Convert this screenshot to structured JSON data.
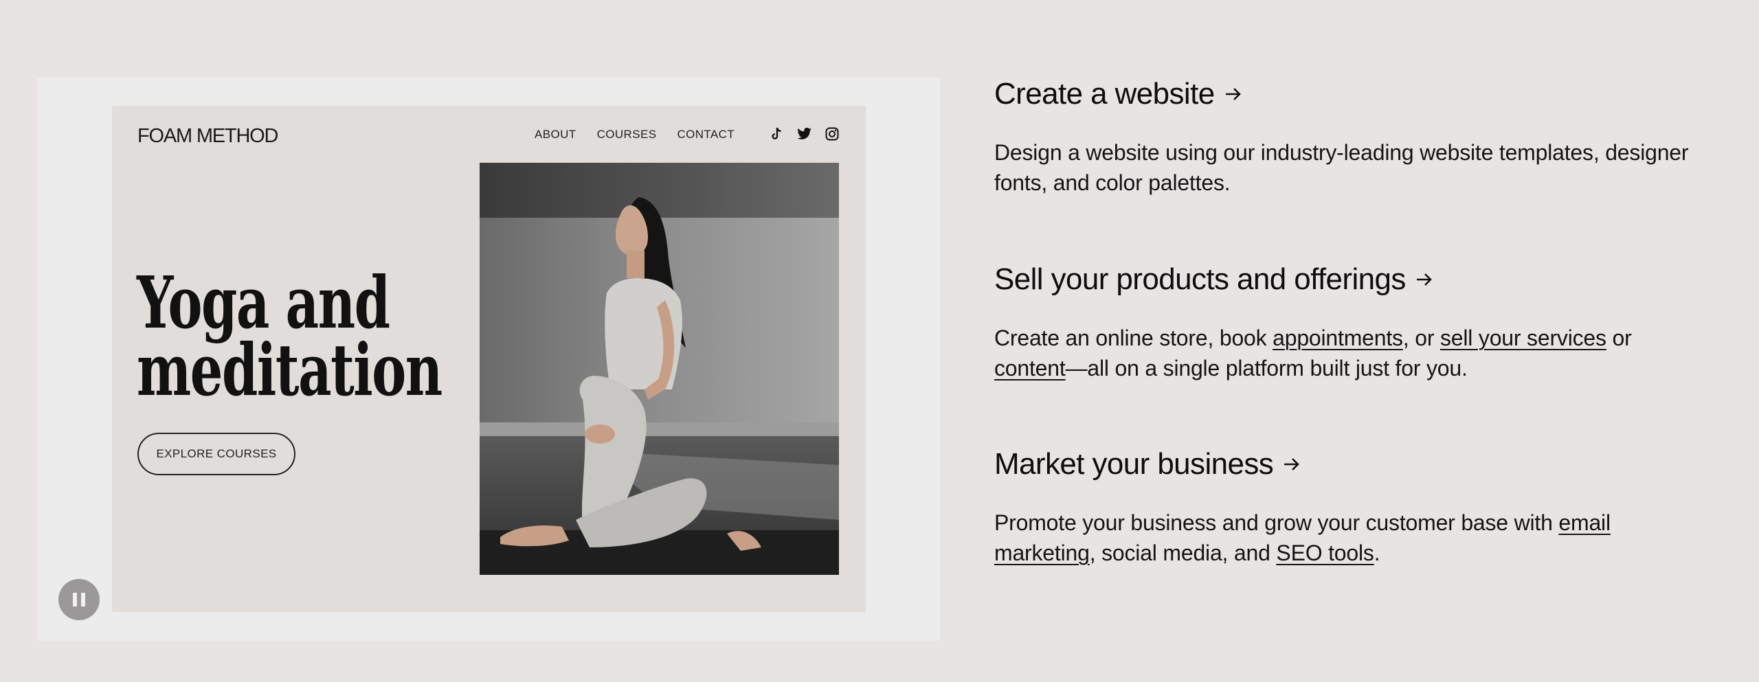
{
  "preview": {
    "brand": "FOAM METHOD",
    "nav": [
      "ABOUT",
      "COURSES",
      "CONTACT"
    ],
    "socials": [
      "tiktok-icon",
      "twitter-icon",
      "instagram-icon"
    ],
    "hero_line1": "Yoga and",
    "hero_line2": "meditation",
    "cta": "EXPLORE COURSES"
  },
  "media": {
    "pause_icon": "pause-icon"
  },
  "features": [
    {
      "title": "Create a website",
      "body": "Design a website using our industry-leading website templates, designer fonts, and color palettes."
    },
    {
      "title": "Sell your products and offerings",
      "body_parts": {
        "t1": "Create an online store, book ",
        "l1": "appointments",
        "t2": ", or ",
        "l2": "sell your services",
        "t3": " or ",
        "l3": "content",
        "t4": "—all on a single platform built just for you."
      }
    },
    {
      "title": "Market your business",
      "body_parts": {
        "t1": "Promote your business and grow your customer base with ",
        "l1": "email marketing",
        "t2": ", social media, and ",
        "l2": "SEO tools",
        "t3": "."
      }
    }
  ],
  "colors": {
    "page_bg": "#e8e4e3",
    "frame_bg": "#ececec",
    "preview_bg": "#e1ddda",
    "text": "#111111"
  }
}
